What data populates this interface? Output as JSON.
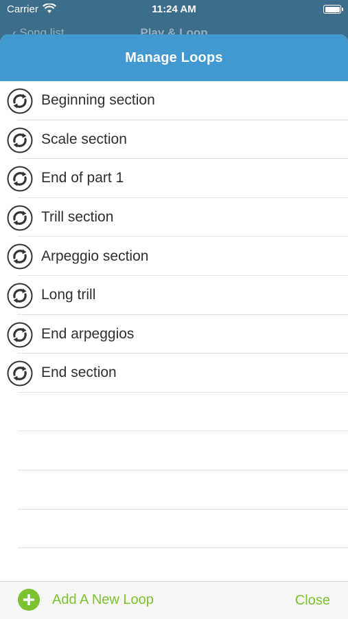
{
  "status_bar": {
    "carrier": "Carrier",
    "time": "11:24 AM"
  },
  "behind_nav": {
    "back_label": "‹ Song list",
    "title": "Play & Loop"
  },
  "sheet": {
    "title": "Manage Loops"
  },
  "loops": [
    {
      "label": "Beginning section",
      "icon": "loop-icon"
    },
    {
      "label": "Scale section",
      "icon": "loop-icon"
    },
    {
      "label": "End of part 1",
      "icon": "loop-icon"
    },
    {
      "label": "Trill section",
      "icon": "loop-icon"
    },
    {
      "label": "Arpeggio section",
      "icon": "loop-icon"
    },
    {
      "label": "Long trill",
      "icon": "loop-icon"
    },
    {
      "label": "End arpeggios",
      "icon": "loop-icon"
    },
    {
      "label": "End section",
      "icon": "loop-icon"
    }
  ],
  "toolbar": {
    "add_label": "Add A New Loop",
    "close_label": "Close",
    "add_icon": "plus-circle-icon"
  },
  "colors": {
    "header": "#4199cf",
    "accent": "#7cc230",
    "behind": "#3c6e8c"
  }
}
